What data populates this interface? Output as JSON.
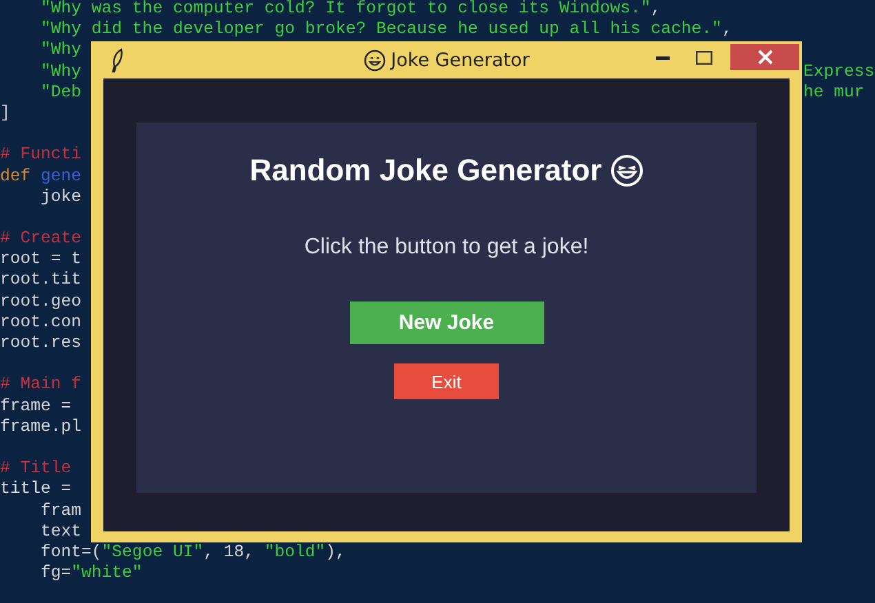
{
  "editor": {
    "lines": [
      {
        "kind": "code",
        "indented": true,
        "left": [
          {
            "kind": "string",
            "text": "\"Why was the computer cold? It forgot to close its Windows.\""
          },
          {
            "kind": "plain",
            "text": ","
          }
        ]
      },
      {
        "kind": "code",
        "indented": true,
        "left": [
          {
            "kind": "string",
            "text": "\"Why did the developer go broke? Because he used up all his cache.\""
          },
          {
            "kind": "plain",
            "text": ","
          }
        ]
      },
      {
        "kind": "code",
        "indented": true,
        "left": [
          {
            "kind": "string",
            "text": "\"Why"
          }
        ]
      },
      {
        "kind": "code",
        "indented": true,
        "left": [
          {
            "kind": "string",
            "text": "\"Why"
          }
        ],
        "right": [
          {
            "kind": "string",
            "text": "Express"
          }
        ]
      },
      {
        "kind": "code",
        "indented": true,
        "left": [
          {
            "kind": "string",
            "text": "\"Deb"
          }
        ],
        "right": [
          {
            "kind": "string",
            "text": "he mur"
          }
        ]
      },
      {
        "kind": "code",
        "left": [
          {
            "kind": "plain",
            "text": "]"
          }
        ]
      },
      {
        "kind": "blank"
      },
      {
        "kind": "code",
        "left": [
          {
            "kind": "comment",
            "text": "# Functi"
          }
        ]
      },
      {
        "kind": "code",
        "left": [
          {
            "kind": "keyword",
            "text": "def"
          },
          {
            "kind": "name",
            "text": "gene"
          }
        ]
      },
      {
        "kind": "code",
        "indented": true,
        "left": [
          {
            "kind": "plain",
            "text": "joke"
          }
        ]
      },
      {
        "kind": "blank"
      },
      {
        "kind": "code",
        "left": [
          {
            "kind": "comment",
            "text": "# Create"
          }
        ]
      },
      {
        "kind": "code",
        "left": [
          {
            "kind": "plain",
            "text": "root = t"
          }
        ]
      },
      {
        "kind": "code",
        "left": [
          {
            "kind": "plain",
            "text": "root.tit"
          }
        ]
      },
      {
        "kind": "code",
        "left": [
          {
            "kind": "plain",
            "text": "root.geo"
          }
        ]
      },
      {
        "kind": "code",
        "left": [
          {
            "kind": "plain",
            "text": "root.con"
          }
        ]
      },
      {
        "kind": "code",
        "left": [
          {
            "kind": "plain",
            "text": "root.res"
          }
        ]
      },
      {
        "kind": "blank"
      },
      {
        "kind": "code",
        "left": [
          {
            "kind": "comment",
            "text": "# Main f"
          }
        ]
      },
      {
        "kind": "code",
        "left": [
          {
            "kind": "plain",
            "text": "frame ="
          }
        ]
      },
      {
        "kind": "code",
        "left": [
          {
            "kind": "plain",
            "text": "frame.pl"
          }
        ]
      },
      {
        "kind": "blank"
      },
      {
        "kind": "code",
        "left": [
          {
            "kind": "comment",
            "text": "# Title"
          }
        ]
      },
      {
        "kind": "code",
        "left": [
          {
            "kind": "plain",
            "text": "title ="
          }
        ]
      },
      {
        "kind": "code",
        "indented": true,
        "left": [
          {
            "kind": "plain",
            "text": "fram"
          }
        ]
      },
      {
        "kind": "code",
        "indented": true,
        "left": [
          {
            "kind": "plain",
            "text": "text"
          }
        ]
      },
      {
        "kind": "code",
        "indented": true,
        "left": [
          {
            "kind": "plain",
            "text": "font=("
          },
          {
            "kind": "string",
            "text": "\"Segoe UI\""
          },
          {
            "kind": "plain",
            "text": ", 18, "
          },
          {
            "kind": "string",
            "text": "\"bold\""
          },
          {
            "kind": "plain",
            "text": "),"
          }
        ]
      },
      {
        "kind": "code",
        "indented": true,
        "left": [
          {
            "kind": "plain",
            "text": "fg="
          },
          {
            "kind": "string",
            "text": "\"white\""
          }
        ]
      }
    ]
  },
  "window": {
    "title": "Joke Generator",
    "heading": "Random Joke Generator",
    "prompt": "Click the button to get a joke!",
    "buttons": [
      {
        "kind": "primary",
        "label": "New Joke"
      },
      {
        "kind": "danger",
        "label": "Exit"
      }
    ]
  }
}
